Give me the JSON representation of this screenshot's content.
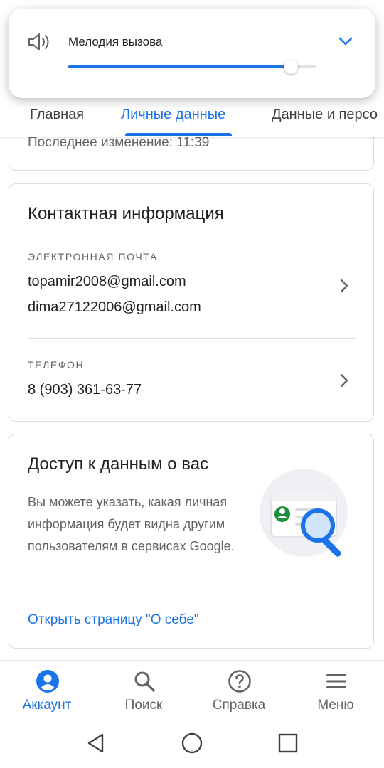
{
  "volume_popup": {
    "title": "Мелодия вызова",
    "level": 0.9,
    "icon": "speaker-icon"
  },
  "tabs": [
    {
      "label": "Главная",
      "active": false
    },
    {
      "label": "Личные данные",
      "active": true
    },
    {
      "label": "Данные и персо",
      "active": false
    }
  ],
  "top_card": {
    "last_modified": "Последнее изменение: 11:39"
  },
  "contact_card": {
    "title": "Контактная информация",
    "email_label": "ЭЛЕКТРОННАЯ ПОЧТА",
    "emails": [
      "topamir2008@gmail.com",
      "dima27122006@gmail.com"
    ],
    "phone_label": "ТЕЛЕФОН",
    "phone": "8 (903) 361-63-77"
  },
  "access_card": {
    "title": "Доступ к данным о вас",
    "description": "Вы можете указать, какая личная информация будет видна другим пользователям в сервисах Google.",
    "link": "Открыть страницу \"О себе\""
  },
  "bottom_nav": [
    {
      "label": "Аккаунт",
      "icon": "account-icon",
      "active": true
    },
    {
      "label": "Поиск",
      "icon": "search-icon",
      "active": false
    },
    {
      "label": "Справка",
      "icon": "help-icon",
      "active": false
    },
    {
      "label": "Меню",
      "icon": "menu-icon",
      "active": false
    }
  ],
  "colors": {
    "accent": "#1a73e8",
    "text": "#202124",
    "secondary": "#5f6368",
    "border": "#dadce0"
  }
}
